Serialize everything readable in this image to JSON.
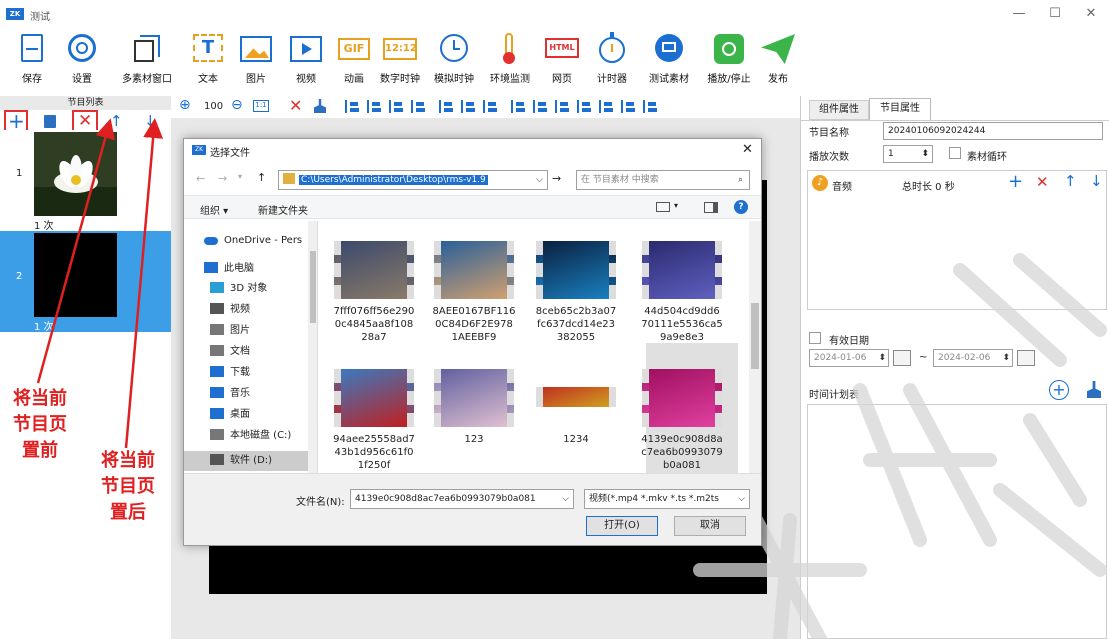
{
  "window": {
    "title": "测试",
    "app_icon": "ZK",
    "min": "—",
    "max": "☐",
    "close": "✕"
  },
  "toolbar": [
    {
      "label": "保存",
      "icon": "save-icon"
    },
    {
      "label": "设置",
      "icon": "gear-icon"
    },
    {
      "label": "多素材窗口",
      "icon": "multi-window-icon"
    },
    {
      "label": "文本",
      "icon": "text-icon",
      "glyph": "T"
    },
    {
      "label": "图片",
      "icon": "picture-icon"
    },
    {
      "label": "视频",
      "icon": "video-icon"
    },
    {
      "label": "动画",
      "icon": "gif-icon",
      "glyph": "GIF"
    },
    {
      "label": "数字时钟",
      "icon": "digital-clock-icon",
      "glyph": "12:12"
    },
    {
      "label": "模拟时钟",
      "icon": "analog-clock-icon"
    },
    {
      "label": "环境监测",
      "icon": "thermometer-icon"
    },
    {
      "label": "网页",
      "icon": "html-icon",
      "glyph": "HTML"
    },
    {
      "label": "计时器",
      "icon": "timer-icon"
    },
    {
      "label": "测试素材",
      "icon": "test-material-icon"
    },
    {
      "label": "播放/停止",
      "icon": "play-stop-icon"
    },
    {
      "label": "发布",
      "icon": "publish-icon"
    }
  ],
  "program_list": {
    "title": "节目列表",
    "items": [
      {
        "index": "1",
        "count": "1 次"
      },
      {
        "index": "2",
        "count": "1 次"
      }
    ]
  },
  "edit_toolbar": {
    "zoom": "100"
  },
  "annotations": {
    "left": "将当前\n节目页\n置前",
    "right": "将当前\n节目页\n置后"
  },
  "right_panel": {
    "tabs": [
      "组件属性",
      "节目属性"
    ],
    "program_name_label": "节目名称",
    "program_name_value": "20240106092024244",
    "play_count_label": "播放次数",
    "play_count_value": "1",
    "loop_label": "素材循环",
    "audio_label": "音频",
    "total_duration": "总时长 0 秒",
    "valid_date_label": "有效日期",
    "date_from": "2024-01-06",
    "date_to": "2024-02-06",
    "date_sep": "~",
    "schedule_label": "时间计划表"
  },
  "dialog": {
    "title": "选择文件",
    "close": "✕",
    "path": "C:\\Users\\Administrator\\Desktop\\rms-v1.9",
    "search_placeholder": "在 节目素材 中搜索",
    "organize": "组织 ▾",
    "new_folder": "新建文件夹",
    "nav": [
      {
        "label": "OneDrive - Pers",
        "icon": "cloud-icon",
        "color": "#1e6fd0"
      },
      {
        "label": "此电脑",
        "icon": "computer-icon",
        "color": "#1e6fd0"
      },
      {
        "label": "3D 对象",
        "icon": "cube-icon",
        "color": "#2a9fd6"
      },
      {
        "label": "视频",
        "icon": "film-icon",
        "color": "#555"
      },
      {
        "label": "图片",
        "icon": "image-folder-icon",
        "color": "#777"
      },
      {
        "label": "文档",
        "icon": "document-icon",
        "color": "#777"
      },
      {
        "label": "下载",
        "icon": "download-icon",
        "color": "#1e6fd0"
      },
      {
        "label": "音乐",
        "icon": "music-icon",
        "color": "#1e6fd0"
      },
      {
        "label": "桌面",
        "icon": "desktop-icon",
        "color": "#1e6fd0"
      },
      {
        "label": "本地磁盘 (C:)",
        "icon": "disk-icon",
        "color": "#777"
      },
      {
        "label": "软件 (D:)",
        "icon": "disk-icon",
        "color": "#555"
      }
    ],
    "files": [
      {
        "name": "7fff076ff56e290\n0c4845aa8f108\n28a7",
        "colors": [
          "#3b4a6b",
          "#8a7a6a"
        ]
      },
      {
        "name": "8AEE0167BF116\n0C84D6F2E978\n1AEEBF9",
        "colors": [
          "#2a5f9a",
          "#d0a070"
        ]
      },
      {
        "name": "8ceb65c2b3a07\nfc637dcd14e23\n382055",
        "colors": [
          "#0a2040",
          "#1a80c0"
        ]
      },
      {
        "name": "44d504cd9dd6\n70111e5536ca5\n9a9e8e3",
        "colors": [
          "#2a2a70",
          "#6060c0"
        ]
      },
      {
        "name": "94aee25558ad7\n43b1d956c61f0\n1f250f",
        "colors": [
          "#3a7ac0",
          "#c02020"
        ]
      },
      {
        "name": "123",
        "colors": [
          "#6060a0",
          "#e0c0d0"
        ]
      },
      {
        "name": "1234",
        "colors": [
          "#c03020",
          "#d0a020"
        ]
      },
      {
        "name": "4139e0c908d8a\nc7ea6b0993079\nb0a081",
        "colors": [
          "#a01060",
          "#e040a0"
        ]
      }
    ],
    "filename_label": "文件名(N):",
    "filename_value": "4139e0c908d8ac7ea6b0993079b0a081",
    "filter": "视频(*.mp4 *.mkv *.ts *.m2ts",
    "open": "打开(O)",
    "cancel": "取消"
  }
}
